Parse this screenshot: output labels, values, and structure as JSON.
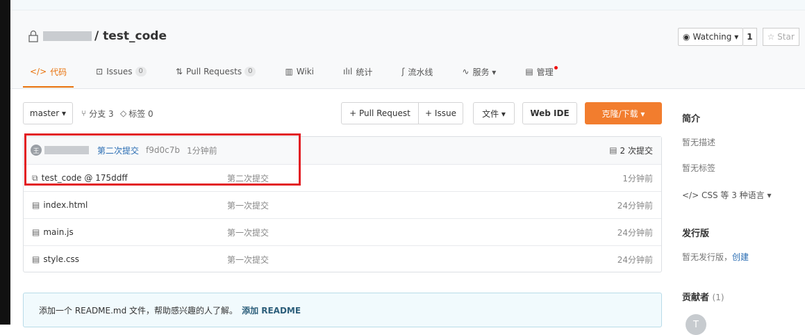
{
  "repo": {
    "name": "/ test_code"
  },
  "watch": {
    "label": "Watching ▾",
    "count": "1",
    "star_label": "☆ Star"
  },
  "tabs": [
    {
      "icon": "</>",
      "label": "代码"
    },
    {
      "icon": "⊡",
      "label": "Issues",
      "badge": "0"
    },
    {
      "icon": "⇅",
      "label": "Pull Requests",
      "badge": "0"
    },
    {
      "icon": "▥",
      "label": "Wiki"
    },
    {
      "icon": "ılıl",
      "label": "统计"
    },
    {
      "icon": "ʃ",
      "label": "流水线"
    },
    {
      "icon": "∿",
      "label": "服务 ▾"
    },
    {
      "icon": "▤",
      "label": "管理"
    }
  ],
  "toolbar": {
    "branch": "master ▾",
    "branches": "分支 3",
    "tags": "标签 0",
    "pull_request": "+ Pull Request",
    "issue": "+ Issue",
    "file": "文件 ▾",
    "web_ide": "Web IDE",
    "clone": "克隆/下载 ▾"
  },
  "latest_commit": {
    "avatar_initial": "王",
    "message": "第二次提交",
    "hash": "f9d0c7b",
    "time": "1分钟前",
    "count": "2 次提交"
  },
  "files": [
    {
      "icon": "⧉",
      "name": "test_code @ 175ddff",
      "message": "第二次提交",
      "time": "1分钟前"
    },
    {
      "icon": "▤",
      "name": "index.html",
      "message": "第一次提交",
      "time": "24分钟前"
    },
    {
      "icon": "▤",
      "name": "main.js",
      "message": "第一次提交",
      "time": "24分钟前"
    },
    {
      "icon": "▤",
      "name": "style.css",
      "message": "第一次提交",
      "time": "24分钟前"
    }
  ],
  "readme": {
    "text": "添加一个 README.md 文件，帮助感兴趣的人了解。",
    "link": "添加 README"
  },
  "sidebar": {
    "intro_title": "简介",
    "no_desc": "暂无描述",
    "no_tags": "暂无标签",
    "languages": "</> CSS 等 3 种语言 ▾",
    "release_title": "发行版",
    "no_release": "暂无发行版，",
    "create": "创建",
    "contributors_title": "贡献者",
    "contributors_count": "(1)",
    "contributor_initial": "T"
  }
}
